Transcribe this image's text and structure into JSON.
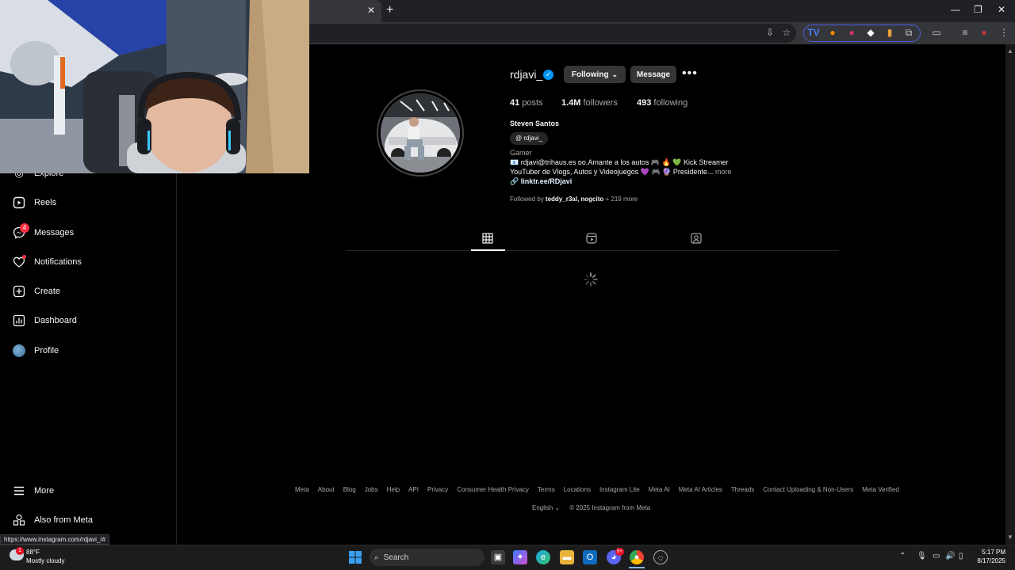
{
  "browser": {
    "tab_close": "✕",
    "new_tab": "+",
    "win_minimize": "—",
    "win_restore": "❐",
    "win_close": "✕"
  },
  "sidebar": {
    "items": [
      {
        "label": "Explore",
        "icon": "compass-icon"
      },
      {
        "label": "Reels",
        "icon": "reels-icon"
      },
      {
        "label": "Messages",
        "icon": "messenger-icon",
        "badge": "4"
      },
      {
        "label": "Notifications",
        "icon": "heart-icon"
      },
      {
        "label": "Create",
        "icon": "plus-square-icon"
      },
      {
        "label": "Dashboard",
        "icon": "bar-chart-icon"
      },
      {
        "label": "Profile",
        "icon": "avatar"
      }
    ],
    "bottom": [
      {
        "label": "More",
        "icon": "hamburger-icon"
      },
      {
        "label": "Also from Meta",
        "icon": "meta-apps-icon"
      }
    ]
  },
  "profile": {
    "username": "rdjavi_",
    "following_button": "Following",
    "message_button": "Message",
    "more": "•••",
    "stats": {
      "posts_count": "41",
      "posts_label": "posts",
      "followers_count": "1.4M",
      "followers_label": "followers",
      "following_count": "493",
      "following_label": "following"
    },
    "full_name": "Steven Santos",
    "threads_handle": "rdjavi_",
    "category": "Gamer",
    "bio_line1": "📧 rdjavi@trihaus.es ᴅᴏ.Amante a los autos 🎮 🔥 💚 Kick Streamer",
    "bio_line2": "YouTuber de Vlogs, Autos y Videojuegos 💜 🎮 🔮 Presidente...",
    "bio_more": "more",
    "link": "linktr.ee/RDjavi",
    "followed_by_prefix": "Followed by",
    "followed_by_names": "teddy_r3al, nogcito",
    "followed_by_suffix": "+ 219 more"
  },
  "footer": {
    "links": [
      "Meta",
      "About",
      "Blog",
      "Jobs",
      "Help",
      "API",
      "Privacy",
      "Consumer Health Privacy",
      "Terms",
      "Locations",
      "Instagram Lite",
      "Meta AI",
      "Meta AI Articles",
      "Threads",
      "Contact Uploading & Non-Users",
      "Meta Verified"
    ],
    "language": "English",
    "copyright": "© 2025 Instagram from Meta"
  },
  "status_url": "https://www.instagram.com/rdjavi_/#",
  "taskbar": {
    "weather_temp": "88°F",
    "weather_desc": "Mostly cloudy",
    "weather_badge": "1",
    "search_label": "Search",
    "discord_badge": "9+",
    "time": "5:17 PM",
    "date": "8/17/2025"
  },
  "colors": {
    "background": "#000000",
    "accent_blue": "#0095f6",
    "badge_red": "#ff3040",
    "button_gray": "#363636"
  }
}
